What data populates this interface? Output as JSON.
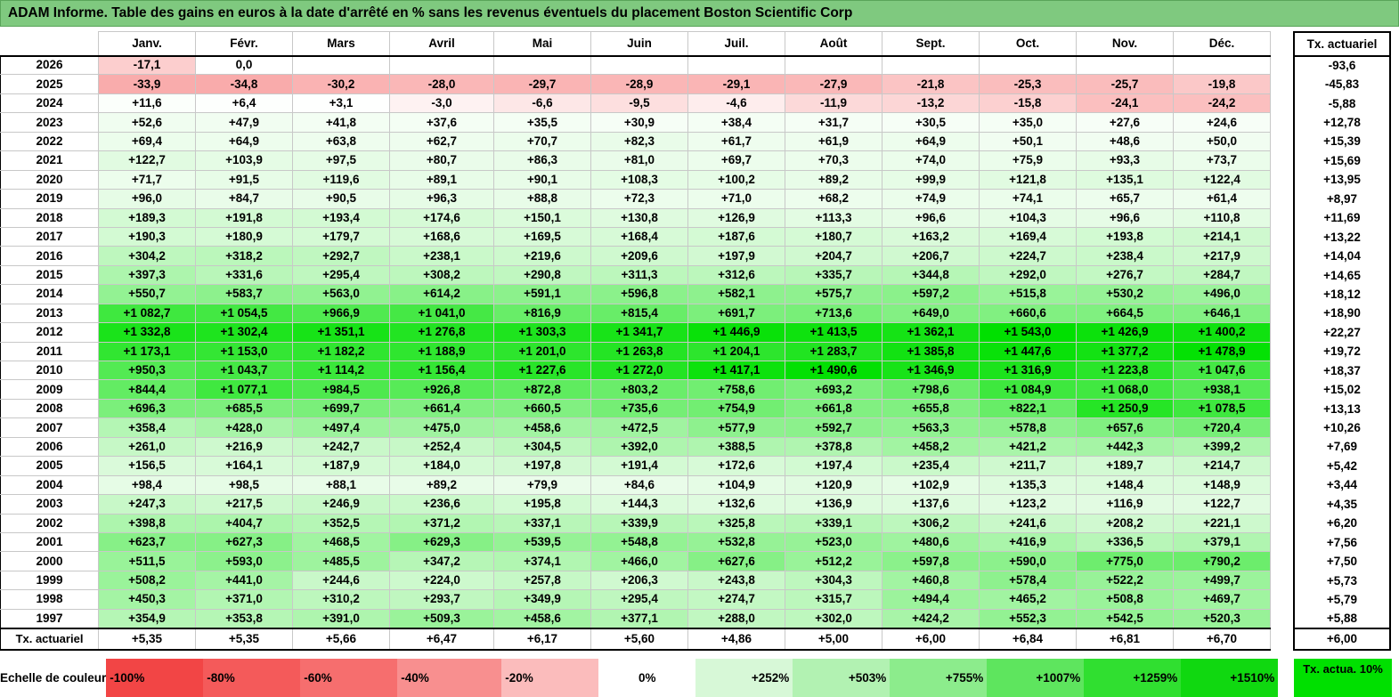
{
  "title": "ADAM Informe. Table des gains en euros à la date d'arrêté en % sans les revenus éventuels du placement Boston Scientific Corp",
  "months": [
    "Janv.",
    "Févr.",
    "Mars",
    "Avril",
    "Mai",
    "Juin",
    "Juil.",
    "Août",
    "Sept.",
    "Oct.",
    "Nov.",
    "Déc."
  ],
  "tx_header": "Tx. actuariel",
  "rows": [
    {
      "year": "2026",
      "values": [
        "-17,1",
        "0,0",
        "",
        "",
        "",
        "",
        "",
        "",
        "",
        "",
        "",
        ""
      ],
      "tx": "-93,6"
    },
    {
      "year": "2025",
      "values": [
        "-33,9",
        "-34,8",
        "-30,2",
        "-28,0",
        "-29,7",
        "-28,9",
        "-29,1",
        "-27,9",
        "-21,8",
        "-25,3",
        "-25,7",
        "-19,8"
      ],
      "tx": "-45,83"
    },
    {
      "year": "2024",
      "values": [
        "+11,6",
        "+6,4",
        "+3,1",
        "-3,0",
        "-6,6",
        "-9,5",
        "-4,6",
        "-11,9",
        "-13,2",
        "-15,8",
        "-24,1",
        "-24,2"
      ],
      "tx": "-5,88"
    },
    {
      "year": "2023",
      "values": [
        "+52,6",
        "+47,9",
        "+41,8",
        "+37,6",
        "+35,5",
        "+30,9",
        "+38,4",
        "+31,7",
        "+30,5",
        "+35,0",
        "+27,6",
        "+24,6"
      ],
      "tx": "+12,78"
    },
    {
      "year": "2022",
      "values": [
        "+69,4",
        "+64,9",
        "+63,8",
        "+62,7",
        "+70,7",
        "+82,3",
        "+61,7",
        "+61,9",
        "+64,9",
        "+50,1",
        "+48,6",
        "+50,0"
      ],
      "tx": "+15,39"
    },
    {
      "year": "2021",
      "values": [
        "+122,7",
        "+103,9",
        "+97,5",
        "+80,7",
        "+86,3",
        "+81,0",
        "+69,7",
        "+70,3",
        "+74,0",
        "+75,9",
        "+93,3",
        "+73,7"
      ],
      "tx": "+15,69"
    },
    {
      "year": "2020",
      "values": [
        "+71,7",
        "+91,5",
        "+119,6",
        "+89,1",
        "+90,1",
        "+108,3",
        "+100,2",
        "+89,2",
        "+99,9",
        "+121,8",
        "+135,1",
        "+122,4"
      ],
      "tx": "+13,95"
    },
    {
      "year": "2019",
      "values": [
        "+96,0",
        "+84,7",
        "+90,5",
        "+96,3",
        "+88,8",
        "+72,3",
        "+71,0",
        "+68,2",
        "+74,9",
        "+74,1",
        "+65,7",
        "+61,4"
      ],
      "tx": "+8,97"
    },
    {
      "year": "2018",
      "values": [
        "+189,3",
        "+191,8",
        "+193,4",
        "+174,6",
        "+150,1",
        "+130,8",
        "+126,9",
        "+113,3",
        "+96,6",
        "+104,3",
        "+96,6",
        "+110,8"
      ],
      "tx": "+11,69"
    },
    {
      "year": "2017",
      "values": [
        "+190,3",
        "+180,9",
        "+179,7",
        "+168,6",
        "+169,5",
        "+168,4",
        "+187,6",
        "+180,7",
        "+163,2",
        "+169,4",
        "+193,8",
        "+214,1"
      ],
      "tx": "+13,22"
    },
    {
      "year": "2016",
      "values": [
        "+304,2",
        "+318,2",
        "+292,7",
        "+238,1",
        "+219,6",
        "+209,6",
        "+197,9",
        "+204,7",
        "+206,7",
        "+224,7",
        "+238,4",
        "+217,9"
      ],
      "tx": "+14,04"
    },
    {
      "year": "2015",
      "values": [
        "+397,3",
        "+331,6",
        "+295,4",
        "+308,2",
        "+290,8",
        "+311,3",
        "+312,6",
        "+335,7",
        "+344,8",
        "+292,0",
        "+276,7",
        "+284,7"
      ],
      "tx": "+14,65"
    },
    {
      "year": "2014",
      "values": [
        "+550,7",
        "+583,7",
        "+563,0",
        "+614,2",
        "+591,1",
        "+596,8",
        "+582,1",
        "+575,7",
        "+597,2",
        "+515,8",
        "+530,2",
        "+496,0"
      ],
      "tx": "+18,12"
    },
    {
      "year": "2013",
      "values": [
        "+1 082,7",
        "+1 054,5",
        "+966,9",
        "+1 041,0",
        "+816,9",
        "+815,4",
        "+691,7",
        "+713,6",
        "+649,0",
        "+660,6",
        "+664,5",
        "+646,1"
      ],
      "tx": "+18,90"
    },
    {
      "year": "2012",
      "values": [
        "+1 332,8",
        "+1 302,4",
        "+1 351,1",
        "+1 276,8",
        "+1 303,3",
        "+1 341,7",
        "+1 446,9",
        "+1 413,5",
        "+1 362,1",
        "+1 543,0",
        "+1 426,9",
        "+1 400,2"
      ],
      "tx": "+22,27"
    },
    {
      "year": "2011",
      "values": [
        "+1 173,1",
        "+1 153,0",
        "+1 182,2",
        "+1 188,9",
        "+1 201,0",
        "+1 263,8",
        "+1 204,1",
        "+1 283,7",
        "+1 385,8",
        "+1 447,6",
        "+1 377,2",
        "+1 478,9"
      ],
      "tx": "+19,72"
    },
    {
      "year": "2010",
      "values": [
        "+950,3",
        "+1 043,7",
        "+1 114,2",
        "+1 156,4",
        "+1 227,6",
        "+1 272,0",
        "+1 417,1",
        "+1 490,6",
        "+1 346,9",
        "+1 316,9",
        "+1 223,8",
        "+1 047,6"
      ],
      "tx": "+18,37"
    },
    {
      "year": "2009",
      "values": [
        "+844,4",
        "+1 077,1",
        "+984,5",
        "+926,8",
        "+872,8",
        "+803,2",
        "+758,6",
        "+693,2",
        "+798,6",
        "+1 084,9",
        "+1 068,0",
        "+938,1"
      ],
      "tx": "+15,02"
    },
    {
      "year": "2008",
      "values": [
        "+696,3",
        "+685,5",
        "+699,7",
        "+661,4",
        "+660,5",
        "+735,6",
        "+754,9",
        "+661,8",
        "+655,8",
        "+822,1",
        "+1 250,9",
        "+1 078,5"
      ],
      "tx": "+13,13"
    },
    {
      "year": "2007",
      "values": [
        "+358,4",
        "+428,0",
        "+497,4",
        "+475,0",
        "+458,6",
        "+472,5",
        "+577,9",
        "+592,7",
        "+563,3",
        "+578,8",
        "+657,6",
        "+720,4"
      ],
      "tx": "+10,26"
    },
    {
      "year": "2006",
      "values": [
        "+261,0",
        "+216,9",
        "+242,7",
        "+252,4",
        "+304,5",
        "+392,0",
        "+388,5",
        "+378,8",
        "+458,2",
        "+421,2",
        "+442,3",
        "+399,2"
      ],
      "tx": "+7,69"
    },
    {
      "year": "2005",
      "values": [
        "+156,5",
        "+164,1",
        "+187,9",
        "+184,0",
        "+197,8",
        "+191,4",
        "+172,6",
        "+197,4",
        "+235,4",
        "+211,7",
        "+189,7",
        "+214,7"
      ],
      "tx": "+5,42"
    },
    {
      "year": "2004",
      "values": [
        "+98,4",
        "+98,5",
        "+88,1",
        "+89,2",
        "+79,9",
        "+84,6",
        "+104,9",
        "+120,9",
        "+102,9",
        "+135,3",
        "+148,4",
        "+148,9"
      ],
      "tx": "+3,44"
    },
    {
      "year": "2003",
      "values": [
        "+247,3",
        "+217,5",
        "+246,9",
        "+236,6",
        "+195,8",
        "+144,3",
        "+132,6",
        "+136,9",
        "+137,6",
        "+123,2",
        "+116,9",
        "+122,7"
      ],
      "tx": "+4,35"
    },
    {
      "year": "2002",
      "values": [
        "+398,8",
        "+404,7",
        "+352,5",
        "+371,2",
        "+337,1",
        "+339,9",
        "+325,8",
        "+339,1",
        "+306,2",
        "+241,6",
        "+208,2",
        "+221,1"
      ],
      "tx": "+6,20"
    },
    {
      "year": "2001",
      "values": [
        "+623,7",
        "+627,3",
        "+468,5",
        "+629,3",
        "+539,5",
        "+548,8",
        "+532,8",
        "+523,0",
        "+480,6",
        "+416,9",
        "+336,5",
        "+379,1"
      ],
      "tx": "+7,56"
    },
    {
      "year": "2000",
      "values": [
        "+511,5",
        "+593,0",
        "+485,5",
        "+347,2",
        "+374,1",
        "+466,0",
        "+627,6",
        "+512,2",
        "+597,8",
        "+590,0",
        "+775,0",
        "+790,2"
      ],
      "tx": "+7,50"
    },
    {
      "year": "1999",
      "values": [
        "+508,2",
        "+441,0",
        "+244,6",
        "+224,0",
        "+257,8",
        "+206,3",
        "+243,8",
        "+304,3",
        "+460,8",
        "+578,4",
        "+522,2",
        "+499,7"
      ],
      "tx": "+5,73"
    },
    {
      "year": "1998",
      "values": [
        "+450,3",
        "+371,0",
        "+310,2",
        "+293,7",
        "+349,9",
        "+295,4",
        "+274,7",
        "+315,7",
        "+494,4",
        "+465,2",
        "+508,8",
        "+469,7"
      ],
      "tx": "+5,79"
    },
    {
      "year": "1997",
      "values": [
        "+354,9",
        "+353,8",
        "+391,0",
        "+509,3",
        "+458,6",
        "+377,1",
        "+288,0",
        "+302,0",
        "+424,2",
        "+552,3",
        "+542,5",
        "+520,3"
      ],
      "tx": "+5,88"
    }
  ],
  "tx_row": {
    "label": "Tx. actuariel",
    "values": [
      "+5,35",
      "+5,35",
      "+5,66",
      "+6,47",
      "+6,17",
      "+5,60",
      "+4,86",
      "+5,00",
      "+6,00",
      "+6,84",
      "+6,81",
      "+6,70"
    ],
    "tx": "+6,00"
  },
  "legend": {
    "label": "Echelle de couleur",
    "steps": [
      {
        "text": "-100%",
        "color": "#f24545"
      },
      {
        "text": "-80%",
        "color": "#f45a5a"
      },
      {
        "text": "-60%",
        "color": "#f66e6e"
      },
      {
        "text": "-40%",
        "color": "#f88f8f"
      },
      {
        "text": "-20%",
        "color": "#fbbcbc"
      },
      {
        "text": "0%",
        "color": "#ffffff"
      },
      {
        "text": "+252%",
        "color": "#d7f8d7"
      },
      {
        "text": "+503%",
        "color": "#b2f2b2"
      },
      {
        "text": "+755%",
        "color": "#8cec8c"
      },
      {
        "text": "+1007%",
        "color": "#5ee55e"
      },
      {
        "text": "+1259%",
        "color": "#30df30"
      },
      {
        "text": "+1510%",
        "color": "#10d810"
      }
    ],
    "tx_label": "Tx. actua. 10%",
    "tx_color": "#00e000"
  },
  "colors": {
    "title_bg": "#7fc97f",
    "positive_max": "#00e000",
    "negative_max": "#f24545"
  }
}
